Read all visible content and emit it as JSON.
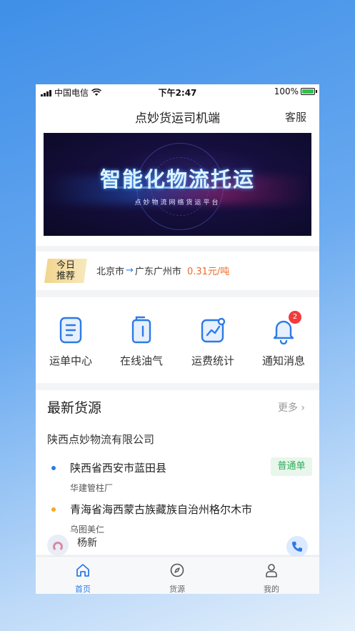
{
  "status_bar": {
    "carrier": "中国电信",
    "time": "下午2:47",
    "battery": "100%"
  },
  "header": {
    "title": "点妙货运司机端",
    "service_label": "客服"
  },
  "banner": {
    "headline": "智能化物流托运",
    "subtitle": "点妙物流网络货运平台"
  },
  "recommend": {
    "tag": "今日推荐",
    "from": "北京市",
    "to": "广东广州市",
    "price": "0.31元/吨"
  },
  "features": [
    {
      "label": "运单中心",
      "icon": "document-icon"
    },
    {
      "label": "在线油气",
      "icon": "fuel-icon"
    },
    {
      "label": "运费统计",
      "icon": "chart-icon"
    },
    {
      "label": "通知消息",
      "icon": "bell-icon",
      "badge": "2"
    }
  ],
  "cargo": {
    "title": "最新货源",
    "more": "更多",
    "company": "陕西点妙物流有限公司",
    "order_type": "普通单",
    "origin": {
      "address": "陕西省西安市蓝田县",
      "detail": "华建管柱厂",
      "color": "#2d7be5"
    },
    "destination": {
      "address": "青海省海西蒙古族藏族自治州格尔木市",
      "detail": "乌图美仁",
      "color": "#f5a623"
    },
    "driver": "杨新"
  },
  "tabbar": [
    {
      "label": "首页",
      "icon": "home-icon",
      "active": true
    },
    {
      "label": "货源",
      "icon": "compass-icon",
      "active": false
    },
    {
      "label": "我的",
      "icon": "user-icon",
      "active": false
    }
  ],
  "colors": {
    "accent": "#2d7be5",
    "price": "#ef6a2a",
    "badge": "#f23b3b",
    "order_tag": "#2cae59"
  }
}
